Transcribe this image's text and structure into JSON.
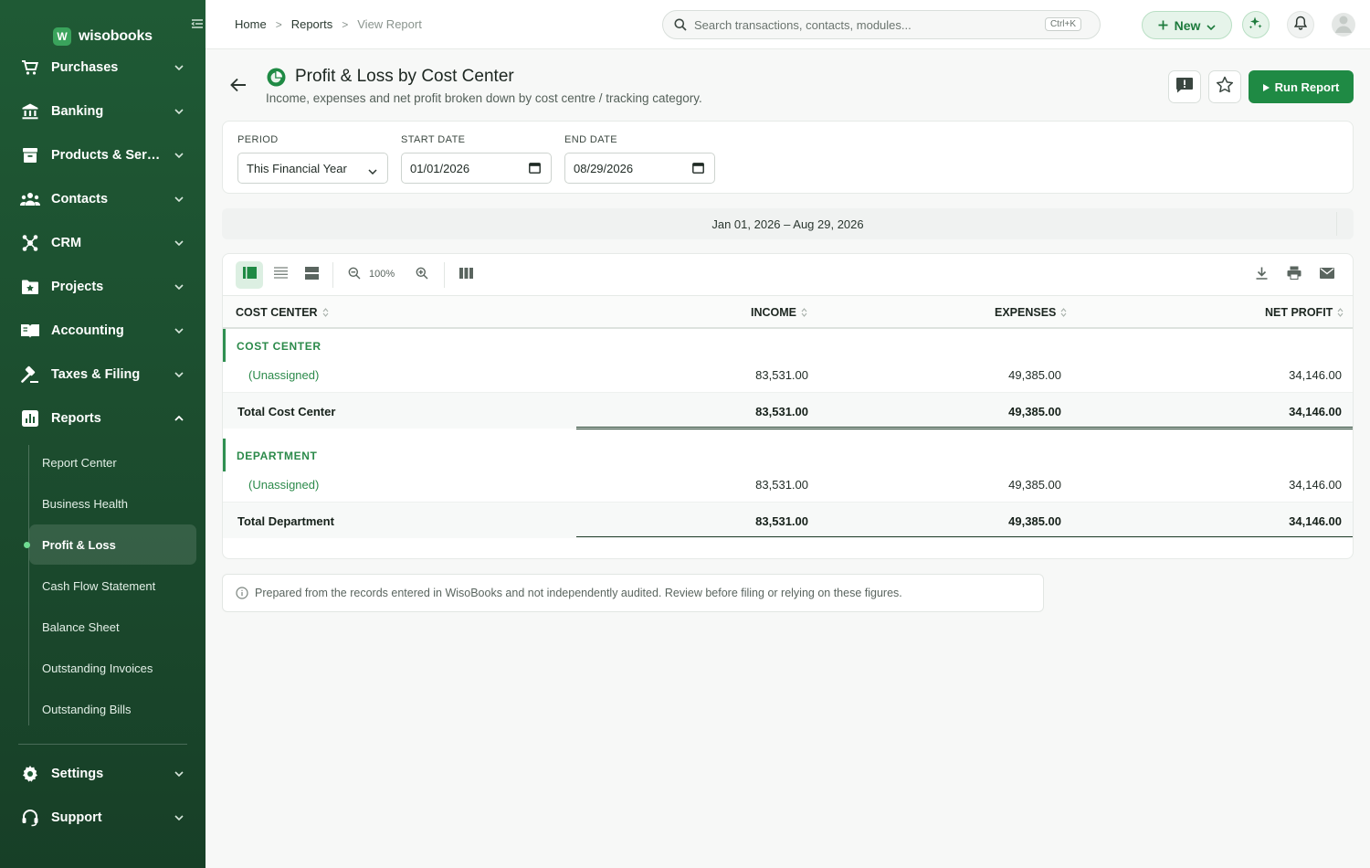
{
  "sidebar": {
    "brand": {
      "logo_letter": "W",
      "name": "wisobooks"
    },
    "collapse_icon": "collapse-sidebar-icon",
    "items": [
      {
        "label": "Purchases",
        "icon": "cart-icon",
        "expanded": false
      },
      {
        "label": "Banking",
        "icon": "bank-icon",
        "expanded": false
      },
      {
        "label": "Products & Services",
        "icon": "box-icon",
        "expanded": false
      },
      {
        "label": "Contacts",
        "icon": "people-icon",
        "expanded": false
      },
      {
        "label": "CRM",
        "icon": "network-icon",
        "expanded": false
      },
      {
        "label": "Projects",
        "icon": "folder-star-icon",
        "expanded": false
      },
      {
        "label": "Accounting",
        "icon": "book-icon",
        "expanded": false
      },
      {
        "label": "Taxes & Filing",
        "icon": "gavel-icon",
        "expanded": false
      },
      {
        "label": "Reports",
        "icon": "chart-icon",
        "expanded": true
      }
    ],
    "report_subitems": [
      {
        "label": "Report Center",
        "active": false
      },
      {
        "label": "Business Health",
        "active": false
      },
      {
        "label": "Profit & Loss",
        "active": true
      },
      {
        "label": "Cash Flow Statement",
        "active": false
      },
      {
        "label": "Balance Sheet",
        "active": false
      },
      {
        "label": "Outstanding Invoices",
        "active": false
      },
      {
        "label": "Outstanding Bills",
        "active": false
      }
    ],
    "bottom_items": [
      {
        "label": "Settings",
        "icon": "gear-icon"
      },
      {
        "label": "Support",
        "icon": "headset-icon"
      }
    ]
  },
  "topbar": {
    "breadcrumbs": [
      "Home",
      "Reports",
      "View Report"
    ],
    "search_placeholder": "Search transactions, contacts, modules...",
    "search_shortcut": "Ctrl+K",
    "new_label": "New"
  },
  "header": {
    "title": "Profit & Loss by Cost Center",
    "subtitle": "Income, expenses and net profit broken down by cost centre / tracking category.",
    "run_label": "Run Report"
  },
  "filters": {
    "period_label": "PERIOD",
    "period_value": "This Financial Year",
    "start_label": "START DATE",
    "start_value": "01/01/2026",
    "end_label": "END DATE",
    "end_value": "08/29/2026"
  },
  "date_range": "Jan 01, 2026 – Aug 29, 2026",
  "toolbar": {
    "zoom": "100%"
  },
  "table": {
    "columns": [
      "COST CENTER",
      "INCOME",
      "EXPENSES",
      "NET PROFIT"
    ],
    "groups": [
      {
        "label": "COST CENTER",
        "rows": [
          {
            "name": "(Unassigned)",
            "income": "83,531.00",
            "expenses": "49,385.00",
            "net": "34,146.00"
          }
        ],
        "total": {
          "name": "Total Cost Center",
          "income": "83,531.00",
          "expenses": "49,385.00",
          "net": "34,146.00"
        }
      },
      {
        "label": "DEPARTMENT",
        "rows": [
          {
            "name": "(Unassigned)",
            "income": "83,531.00",
            "expenses": "49,385.00",
            "net": "34,146.00"
          }
        ],
        "total": {
          "name": "Total Department",
          "income": "83,531.00",
          "expenses": "49,385.00",
          "net": "34,146.00"
        }
      }
    ]
  },
  "note": "Prepared from the records entered in WisoBooks and not independently audited. Review before filing or relying on these figures.",
  "colors": {
    "sidebar": "#1f5a35",
    "accent": "#1f8a44",
    "group_label": "#2b8a4a"
  }
}
